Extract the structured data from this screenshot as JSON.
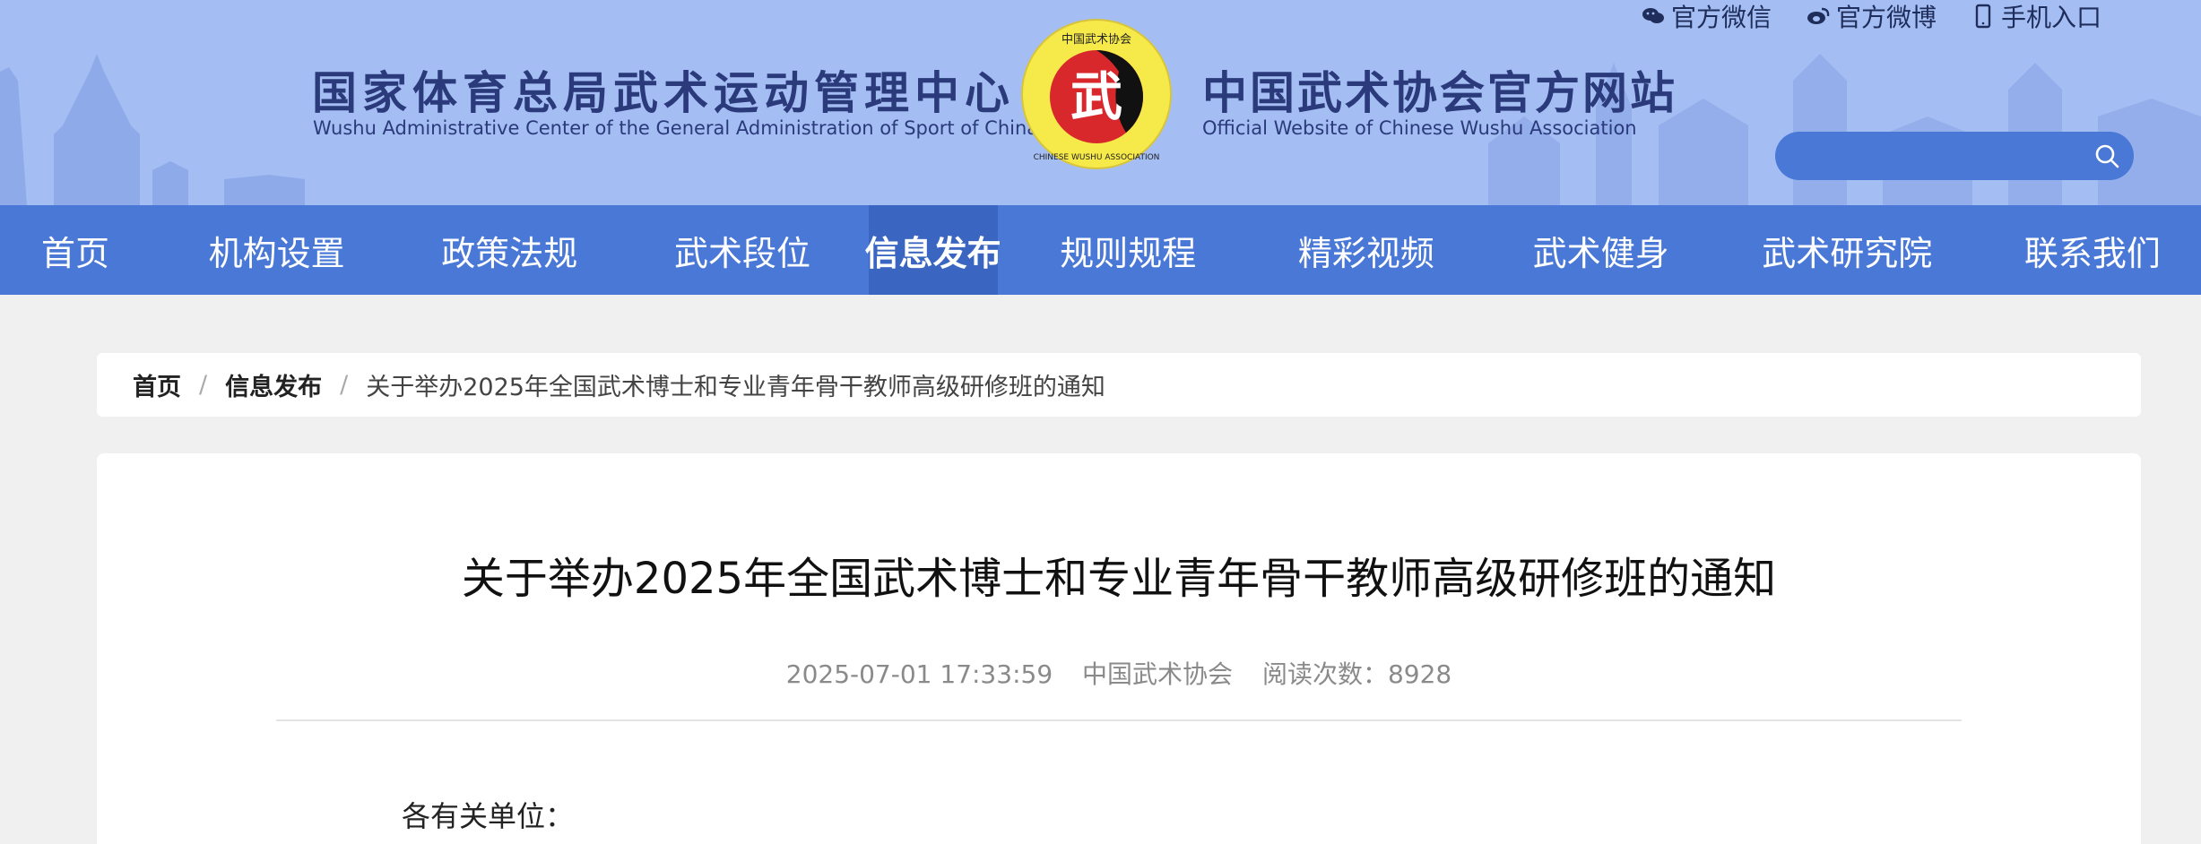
{
  "header": {
    "title_cn": "国家体育总局武术运动管理中心",
    "title_en": "Wushu Administrative Center of the General Administration of Sport of China",
    "site_cn": "中国武术协会官方网站",
    "site_en": "Official Website of Chinese Wushu Association",
    "logo": {
      "char": "武",
      "text_cn": "中国武术协会",
      "text_en": "CHINESE WUSHU ASSOCIATION"
    },
    "toplinks": [
      {
        "label": "官方微信",
        "icon": "wechat-icon"
      },
      {
        "label": "官方微博",
        "icon": "weibo-icon"
      },
      {
        "label": "手机入口",
        "icon": "mobile-icon"
      }
    ],
    "search": {
      "placeholder": ""
    }
  },
  "nav": {
    "items": [
      {
        "label": "首页"
      },
      {
        "label": "机构设置"
      },
      {
        "label": "政策法规"
      },
      {
        "label": "武术段位"
      },
      {
        "label": "信息发布",
        "active": true
      },
      {
        "label": "规则规程"
      },
      {
        "label": "精彩视频"
      },
      {
        "label": "武术健身"
      },
      {
        "label": "武术研究院"
      },
      {
        "label": "联系我们"
      }
    ]
  },
  "breadcrumb": {
    "home": "首页",
    "sep": "/",
    "section": "信息发布",
    "current": "关于举办2025年全国武术博士和专业青年骨干教师高级研修班的通知"
  },
  "article": {
    "title": "关于举办2025年全国武术博士和专业青年骨干教师高级研修班的通知",
    "date": "2025-07-01 17:33:59",
    "source": "中国武术协会",
    "views": "阅读次数：8928",
    "salutation": "各有关单位："
  },
  "colors": {
    "header_bg": "#a4bef4",
    "nav_bg": "#4a78d6",
    "nav_active": "#3a65c0",
    "title_text": "#2a3a7a"
  }
}
